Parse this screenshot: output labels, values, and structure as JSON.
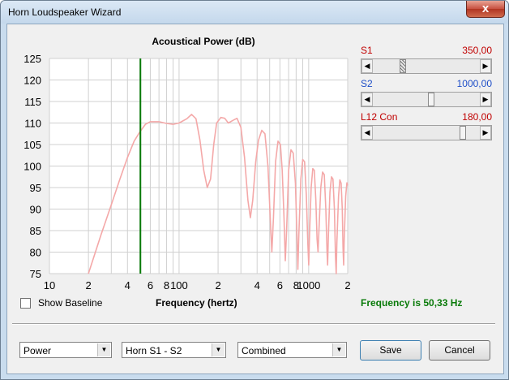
{
  "window": {
    "title": "Horn Loudspeaker Wizard",
    "close_glyph": "x"
  },
  "chart_data": {
    "type": "line",
    "title": "Acoustical Power (dB)",
    "xlabel": "Frequency (hertz)",
    "ylabel": "",
    "xscale": "log",
    "xlim": [
      10,
      2000
    ],
    "ylim": [
      75,
      125
    ],
    "yticks": [
      75,
      80,
      85,
      90,
      95,
      100,
      105,
      110,
      115,
      120,
      125
    ],
    "xtick_labels": [
      {
        "x": 10,
        "label": "10"
      },
      {
        "x": 20,
        "label": "2"
      },
      {
        "x": 40,
        "label": "4"
      },
      {
        "x": 60,
        "label": "6"
      },
      {
        "x": 80,
        "label": "8"
      },
      {
        "x": 100,
        "label": "100"
      },
      {
        "x": 200,
        "label": "2"
      },
      {
        "x": 400,
        "label": "4"
      },
      {
        "x": 600,
        "label": "6"
      },
      {
        "x": 800,
        "label": "8"
      },
      {
        "x": 1000,
        "label": "1000"
      },
      {
        "x": 2000,
        "label": "2"
      }
    ],
    "grid": true,
    "marker_x": 50.33,
    "series": [
      {
        "color": "#f4a8a8",
        "points": [
          [
            20,
            75
          ],
          [
            25,
            84
          ],
          [
            30,
            91
          ],
          [
            35,
            97
          ],
          [
            40,
            102
          ],
          [
            45,
            105.8
          ],
          [
            50,
            108
          ],
          [
            55,
            109.7
          ],
          [
            60,
            110.3
          ],
          [
            70,
            110.3
          ],
          [
            80,
            109.9
          ],
          [
            90,
            109.7
          ],
          [
            100,
            110
          ],
          [
            115,
            111
          ],
          [
            125,
            112
          ],
          [
            135,
            111
          ],
          [
            145,
            106
          ],
          [
            155,
            99
          ],
          [
            165,
            95
          ],
          [
            175,
            97
          ],
          [
            185,
            105
          ],
          [
            195,
            110
          ],
          [
            210,
            111.3
          ],
          [
            225,
            111.1
          ],
          [
            240,
            110
          ],
          [
            260,
            110.6
          ],
          [
            280,
            111.1
          ],
          [
            300,
            109
          ],
          [
            320,
            102
          ],
          [
            340,
            92
          ],
          [
            355,
            88
          ],
          [
            370,
            92
          ],
          [
            390,
            101
          ],
          [
            410,
            106
          ],
          [
            435,
            108.3
          ],
          [
            460,
            107.5
          ],
          [
            485,
            100
          ],
          [
            505,
            88
          ],
          [
            520,
            80
          ],
          [
            535,
            88
          ],
          [
            555,
            101
          ],
          [
            580,
            105.8
          ],
          [
            605,
            105
          ],
          [
            625,
            99
          ],
          [
            645,
            88
          ],
          [
            660,
            78
          ],
          [
            675,
            85
          ],
          [
            700,
            99
          ],
          [
            730,
            103.8
          ],
          [
            760,
            103
          ],
          [
            790,
            96
          ],
          [
            810,
            85
          ],
          [
            825,
            76
          ],
          [
            840,
            84
          ],
          [
            870,
            97
          ],
          [
            900,
            101.5
          ],
          [
            930,
            101
          ],
          [
            960,
            93
          ],
          [
            985,
            82
          ],
          [
            1000,
            77
          ],
          [
            1015,
            84
          ],
          [
            1045,
            95
          ],
          [
            1075,
            99.4
          ],
          [
            1105,
            99
          ],
          [
            1135,
            92
          ],
          [
            1160,
            83
          ],
          [
            1180,
            80
          ],
          [
            1200,
            85
          ],
          [
            1240,
            95
          ],
          [
            1280,
            98.6
          ],
          [
            1320,
            98
          ],
          [
            1355,
            90
          ],
          [
            1385,
            80
          ],
          [
            1400,
            77
          ],
          [
            1420,
            84
          ],
          [
            1460,
            94
          ],
          [
            1500,
            97.5
          ],
          [
            1540,
            97
          ],
          [
            1580,
            90
          ],
          [
            1610,
            79
          ],
          [
            1630,
            75
          ],
          [
            1650,
            82
          ],
          [
            1700,
            93
          ],
          [
            1740,
            96.8
          ],
          [
            1780,
            96
          ],
          [
            1815,
            90
          ],
          [
            1840,
            81
          ],
          [
            1860,
            77
          ],
          [
            1880,
            83
          ],
          [
            1930,
            93
          ],
          [
            1970,
            96.1
          ],
          [
            2000,
            95.5
          ]
        ]
      }
    ]
  },
  "params": [
    {
      "label": "S1",
      "value": "350,00",
      "color": "#c00000",
      "level": 0.27
    },
    {
      "label": "S2",
      "value": "1000,00",
      "color": "#1f4fc8",
      "level": 0.55
    },
    {
      "label": "L12 Con",
      "value": "180,00",
      "color": "#c00000",
      "level": 0.86
    }
  ],
  "controls": {
    "show_baseline_label": "Show Baseline",
    "axis_label": "Frequency (hertz)",
    "frequency_status": "Frequency is 50,33 Hz",
    "dropdowns": [
      "Power",
      "Horn S1 - S2",
      "Combined"
    ],
    "save_label": "Save",
    "cancel_label": "Cancel"
  },
  "icons": {
    "arrow_left": "◀",
    "arrow_right": "▶",
    "arrow_down": "▼"
  }
}
